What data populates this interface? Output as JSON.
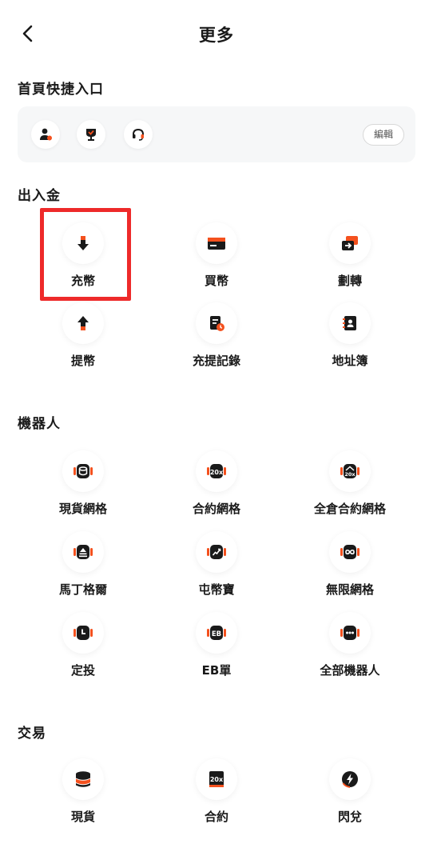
{
  "header": {
    "title": "更多",
    "back_icon": "chevron-left-icon"
  },
  "quick_entry": {
    "title": "首頁快捷入口",
    "icons": [
      "user-add-icon",
      "trophy-icon",
      "headset-icon"
    ],
    "edit_label": "編輯"
  },
  "deposit": {
    "title": "出入金",
    "items": [
      {
        "label": "充幣",
        "icon": "arrow-down-icon"
      },
      {
        "label": "買幣",
        "icon": "card-icon"
      },
      {
        "label": "劃轉",
        "icon": "transfer-icon"
      },
      {
        "label": "提幣",
        "icon": "arrow-up-icon"
      },
      {
        "label": "充提記錄",
        "icon": "record-icon"
      },
      {
        "label": "地址簿",
        "icon": "address-book-icon"
      }
    ]
  },
  "bots": {
    "title": "機器人",
    "items": [
      {
        "label": "現貨網格",
        "icon": "spot-grid-icon"
      },
      {
        "label": "合約網格",
        "icon": "futures-grid-icon",
        "badge": "20x"
      },
      {
        "label": "全倉合約網格",
        "icon": "cross-grid-icon",
        "badge": "20x"
      },
      {
        "label": "馬丁格爾",
        "icon": "martingale-icon"
      },
      {
        "label": "屯幣寶",
        "icon": "hodl-icon"
      },
      {
        "label": "無限網格",
        "icon": "infinity-grid-icon",
        "badge": "∞"
      },
      {
        "label": "定投",
        "icon": "dca-clock-icon"
      },
      {
        "label": "EB單",
        "icon": "eb-order-icon",
        "badge": "EB"
      },
      {
        "label": "全部機器人",
        "icon": "more-dots-icon"
      }
    ]
  },
  "trade": {
    "title": "交易",
    "items": [
      {
        "label": "現貨",
        "icon": "coins-icon"
      },
      {
        "label": "合約",
        "icon": "futures-icon",
        "badge": "20x"
      },
      {
        "label": "閃兌",
        "icon": "lightning-icon"
      }
    ]
  },
  "colors": {
    "accent": "#f4511e",
    "dark": "#1a1a1a",
    "highlight": "#ee2a2a"
  }
}
